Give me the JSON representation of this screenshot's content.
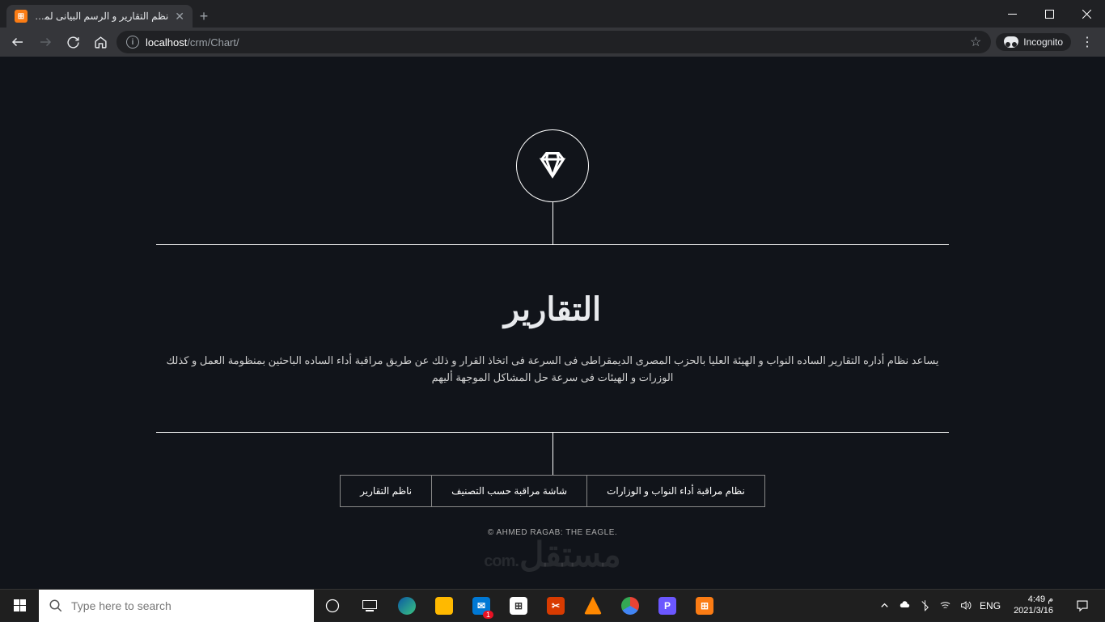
{
  "browser": {
    "tab_title": "نظم التقارير و الرسم البيانى لمنظو",
    "url_host": "localhost",
    "url_path": "/crm/Chart/",
    "incognito_label": "Incognito"
  },
  "page": {
    "title": "التقارير",
    "description": "يساعد نظام أداره التقارير الساده النواب و الهيئة العليا بالحزب المصرى الديمقراطى فى السرعة فى اتخاذ القرار و ذلك عن طريق مراقبة أداء الساده الباحثين بمنظومة العمل و كذلك الوزرات و الهيئات فى سرعة حل المشاكل الموجهة أليهم",
    "tabs": [
      {
        "label": "نظام مراقبة أداء النواب و الوزارات"
      },
      {
        "label": "شاشة مراقبة حسب التصنيف"
      },
      {
        "label": "ناظم التقارير"
      }
    ],
    "copyright": "© AHMED RAGAB: THE EAGLE.",
    "watermark": "مستقل",
    "watermark_ext": ".com"
  },
  "taskbar": {
    "search_placeholder": "Type here to search",
    "lang": "ENG",
    "time": "4:49 م",
    "date": "2021/3/16",
    "mail_badge": "1"
  }
}
